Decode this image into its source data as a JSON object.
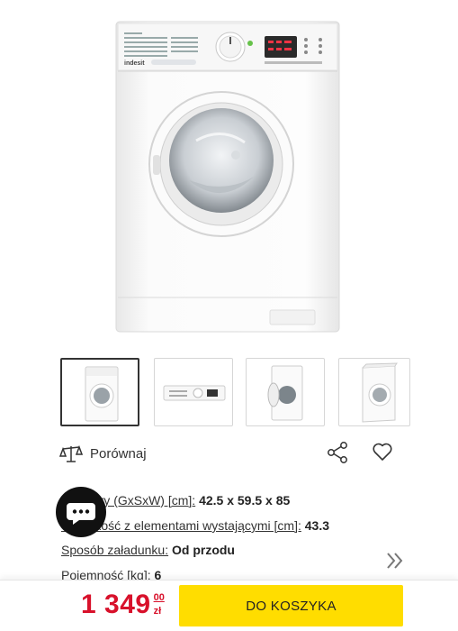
{
  "product": {
    "brand_logo": "indesit"
  },
  "gallery": {
    "thumbnails": [
      {
        "name": "front-view",
        "selected": true
      },
      {
        "name": "control-panel-view",
        "selected": false
      },
      {
        "name": "open-door-view",
        "selected": false
      },
      {
        "name": "angled-view",
        "selected": false
      }
    ]
  },
  "actions": {
    "compare_label": "Porównaj",
    "compare_icon": "scale-icon",
    "share_icon": "share-icon",
    "favorite_icon": "heart-icon"
  },
  "specs": [
    {
      "key": "Wymiary (GxSxW) [cm]:",
      "value": "42.5 x 59.5 x 85"
    },
    {
      "key": "Głębokość z elementami wystającymi [cm]:",
      "value": "43.3"
    },
    {
      "key": "Sposób załadunku:",
      "value": "Od przodu"
    },
    {
      "key": "Pojemność [kg]:",
      "value": "6"
    }
  ],
  "chat": {
    "icon": "chat-bubble-icon"
  },
  "more": {
    "icon": "double-chevron-right-icon"
  },
  "buy_bar": {
    "price_int": "1 349",
    "price_cents": "00",
    "currency": "zł",
    "add_to_cart_label": "DO KOSZYKA",
    "accent_color": "#ffdd00",
    "price_color": "#d8112b"
  }
}
